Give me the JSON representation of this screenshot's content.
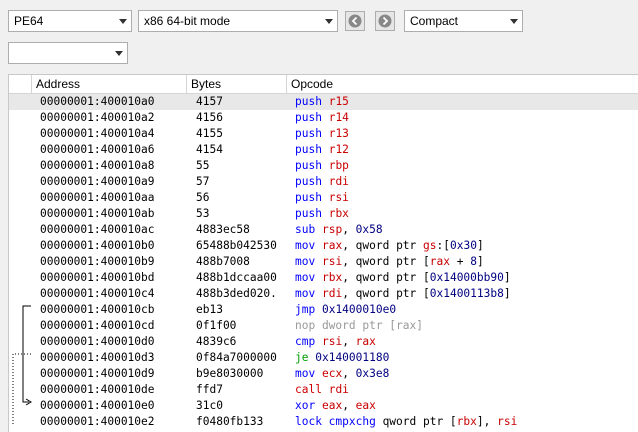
{
  "toolbar": {
    "arch": "PE64",
    "mode": "x86 64-bit mode",
    "view": "Compact",
    "second_combo": ""
  },
  "columns": {
    "address": "Address",
    "bytes": "Bytes",
    "opcode": "Opcode"
  },
  "colors": {
    "mnemonic": "#0000ff",
    "register": "#c80000",
    "number": "#000080",
    "jump": "#00a000",
    "call": "#d00000",
    "nop": "#999999"
  },
  "rows": [
    {
      "address": "00000001:400010a0",
      "bytes": "4157",
      "parts": [
        {
          "t": "push",
          "c": "mn"
        },
        {
          "t": " ",
          "c": "pl"
        },
        {
          "t": "r15",
          "c": "rg"
        }
      ]
    },
    {
      "address": "00000001:400010a2",
      "bytes": "4156",
      "parts": [
        {
          "t": "push",
          "c": "mn"
        },
        {
          "t": " ",
          "c": "pl"
        },
        {
          "t": "r14",
          "c": "rg"
        }
      ]
    },
    {
      "address": "00000001:400010a4",
      "bytes": "4155",
      "parts": [
        {
          "t": "push",
          "c": "mn"
        },
        {
          "t": " ",
          "c": "pl"
        },
        {
          "t": "r13",
          "c": "rg"
        }
      ]
    },
    {
      "address": "00000001:400010a6",
      "bytes": "4154",
      "parts": [
        {
          "t": "push",
          "c": "mn"
        },
        {
          "t": " ",
          "c": "pl"
        },
        {
          "t": "r12",
          "c": "rg"
        }
      ]
    },
    {
      "address": "00000001:400010a8",
      "bytes": "55",
      "parts": [
        {
          "t": "push",
          "c": "mn"
        },
        {
          "t": " ",
          "c": "pl"
        },
        {
          "t": "rbp",
          "c": "rg"
        }
      ]
    },
    {
      "address": "00000001:400010a9",
      "bytes": "57",
      "parts": [
        {
          "t": "push",
          "c": "mn"
        },
        {
          "t": " ",
          "c": "pl"
        },
        {
          "t": "rdi",
          "c": "rg"
        }
      ]
    },
    {
      "address": "00000001:400010aa",
      "bytes": "56",
      "parts": [
        {
          "t": "push",
          "c": "mn"
        },
        {
          "t": " ",
          "c": "pl"
        },
        {
          "t": "rsi",
          "c": "rg"
        }
      ]
    },
    {
      "address": "00000001:400010ab",
      "bytes": "53",
      "parts": [
        {
          "t": "push",
          "c": "mn"
        },
        {
          "t": " ",
          "c": "pl"
        },
        {
          "t": "rbx",
          "c": "rg"
        }
      ]
    },
    {
      "address": "00000001:400010ac",
      "bytes": "4883ec58",
      "parts": [
        {
          "t": "sub",
          "c": "mn"
        },
        {
          "t": " ",
          "c": "pl"
        },
        {
          "t": "rsp",
          "c": "rg"
        },
        {
          "t": ", ",
          "c": "pl"
        },
        {
          "t": "0x58",
          "c": "nm"
        }
      ]
    },
    {
      "address": "00000001:400010b0",
      "bytes": "65488b042530",
      "parts": [
        {
          "t": "mov",
          "c": "mn"
        },
        {
          "t": " ",
          "c": "pl"
        },
        {
          "t": "rax",
          "c": "rg"
        },
        {
          "t": ", qword ptr ",
          "c": "pl"
        },
        {
          "t": "gs",
          "c": "rg"
        },
        {
          "t": ":[",
          "c": "pl"
        },
        {
          "t": "0x30",
          "c": "nm"
        },
        {
          "t": "]",
          "c": "pl"
        }
      ]
    },
    {
      "address": "00000001:400010b9",
      "bytes": "488b7008",
      "parts": [
        {
          "t": "mov",
          "c": "mn"
        },
        {
          "t": " ",
          "c": "pl"
        },
        {
          "t": "rsi",
          "c": "rg"
        },
        {
          "t": ", qword ptr [",
          "c": "pl"
        },
        {
          "t": "rax",
          "c": "rg"
        },
        {
          "t": " + ",
          "c": "pl"
        },
        {
          "t": "8",
          "c": "nm"
        },
        {
          "t": "]",
          "c": "pl"
        }
      ]
    },
    {
      "address": "00000001:400010bd",
      "bytes": "488b1dccaa00",
      "parts": [
        {
          "t": "mov",
          "c": "mn"
        },
        {
          "t": " ",
          "c": "pl"
        },
        {
          "t": "rbx",
          "c": "rg"
        },
        {
          "t": ", qword ptr [",
          "c": "pl"
        },
        {
          "t": "0x14000bb90",
          "c": "nm"
        },
        {
          "t": "]",
          "c": "pl"
        }
      ]
    },
    {
      "address": "00000001:400010c4",
      "bytes": "488b3ded020.",
      "parts": [
        {
          "t": "mov",
          "c": "mn"
        },
        {
          "t": " ",
          "c": "pl"
        },
        {
          "t": "rdi",
          "c": "rg"
        },
        {
          "t": ", qword ptr [",
          "c": "pl"
        },
        {
          "t": "0x1400113b8",
          "c": "nm"
        },
        {
          "t": "]",
          "c": "pl"
        }
      ]
    },
    {
      "address": "00000001:400010cb",
      "bytes": "eb13",
      "parts": [
        {
          "t": "jmp",
          "c": "mn"
        },
        {
          "t": " ",
          "c": "pl"
        },
        {
          "t": "0x1400010e0",
          "c": "nm"
        }
      ]
    },
    {
      "address": "00000001:400010cd",
      "bytes": "0f1f00",
      "parts": [
        {
          "t": "nop dword ptr [rax]",
          "c": "fd"
        }
      ]
    },
    {
      "address": "00000001:400010d0",
      "bytes": "4839c6",
      "parts": [
        {
          "t": "cmp",
          "c": "mn"
        },
        {
          "t": " ",
          "c": "pl"
        },
        {
          "t": "rsi",
          "c": "rg"
        },
        {
          "t": ", ",
          "c": "pl"
        },
        {
          "t": "rax",
          "c": "rg"
        }
      ]
    },
    {
      "address": "00000001:400010d3",
      "bytes": "0f84a7000000",
      "parts": [
        {
          "t": "je",
          "c": "cj"
        },
        {
          "t": " ",
          "c": "pl"
        },
        {
          "t": "0x140001180",
          "c": "nm"
        }
      ]
    },
    {
      "address": "00000001:400010d9",
      "bytes": "b9e8030000",
      "parts": [
        {
          "t": "mov",
          "c": "mn"
        },
        {
          "t": " ",
          "c": "pl"
        },
        {
          "t": "ecx",
          "c": "rg"
        },
        {
          "t": ", ",
          "c": "pl"
        },
        {
          "t": "0x3e8",
          "c": "nm"
        }
      ]
    },
    {
      "address": "00000001:400010de",
      "bytes": "ffd7",
      "parts": [
        {
          "t": "call",
          "c": "cl"
        },
        {
          "t": " ",
          "c": "pl"
        },
        {
          "t": "rdi",
          "c": "rg"
        }
      ]
    },
    {
      "address": "00000001:400010e0",
      "bytes": "31c0",
      "parts": [
        {
          "t": "xor",
          "c": "mn"
        },
        {
          "t": " ",
          "c": "pl"
        },
        {
          "t": "eax",
          "c": "rg"
        },
        {
          "t": ", ",
          "c": "pl"
        },
        {
          "t": "eax",
          "c": "rg"
        }
      ]
    },
    {
      "address": "00000001:400010e2",
      "bytes": "f0480fb133",
      "parts": [
        {
          "t": "lock cmpxchg",
          "c": "mn"
        },
        {
          "t": " qword ptr [",
          "c": "pl"
        },
        {
          "t": "rbx",
          "c": "rg"
        },
        {
          "t": "], ",
          "c": "pl"
        },
        {
          "t": "rsi",
          "c": "rg"
        }
      ]
    }
  ]
}
